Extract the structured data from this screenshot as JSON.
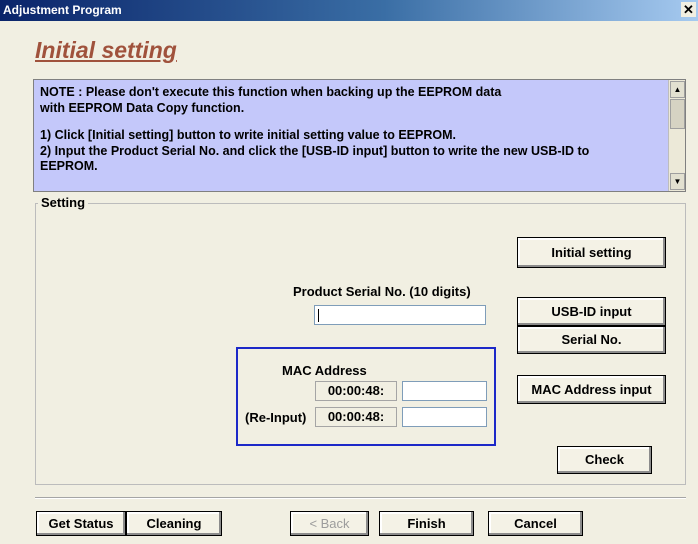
{
  "window": {
    "title": "Adjustment Program",
    "close_glyph": "✕"
  },
  "page": {
    "heading": "Initial setting"
  },
  "note": {
    "lines": [
      "NOTE : Please don't execute this function when backing up the EEPROM data",
      "with EEPROM Data Copy function.",
      "",
      "1) Click [Initial setting] button to write initial setting value to EEPROM.",
      "2) Input the Product Serial No. and click the [USB-ID input] button to write the new USB-ID to",
      "EEPROM."
    ],
    "bg_color": "#c4c8fa"
  },
  "setting": {
    "legend": "Setting",
    "initial_setting_button": "Initial setting",
    "serial_label": "Product Serial No. (10 digits)",
    "serial_value": "",
    "usb_id_button": "USB-ID input",
    "serial_no_button": "Serial No.",
    "mac": {
      "title": "MAC Address",
      "prefix": "00:00:48:",
      "reinput_label": "(Re-Input)",
      "reinput_prefix": "00:00:48:",
      "value": "",
      "reinput_value": "",
      "frame_color": "#1c28c8"
    },
    "mac_input_button": "MAC Address input",
    "check_button": "Check"
  },
  "footer": {
    "get_status": "Get Status",
    "cleaning": "Cleaning",
    "back": "< Back",
    "finish": "Finish",
    "cancel": "Cancel"
  },
  "colors": {
    "heading": "#a0523c",
    "title_bar": "#0a246a",
    "window_bg": "#f1efe2"
  },
  "icons": {
    "close": "close-icon",
    "scroll_up": "scroll-up-arrow-icon",
    "scroll_down": "scroll-down-arrow-icon"
  }
}
